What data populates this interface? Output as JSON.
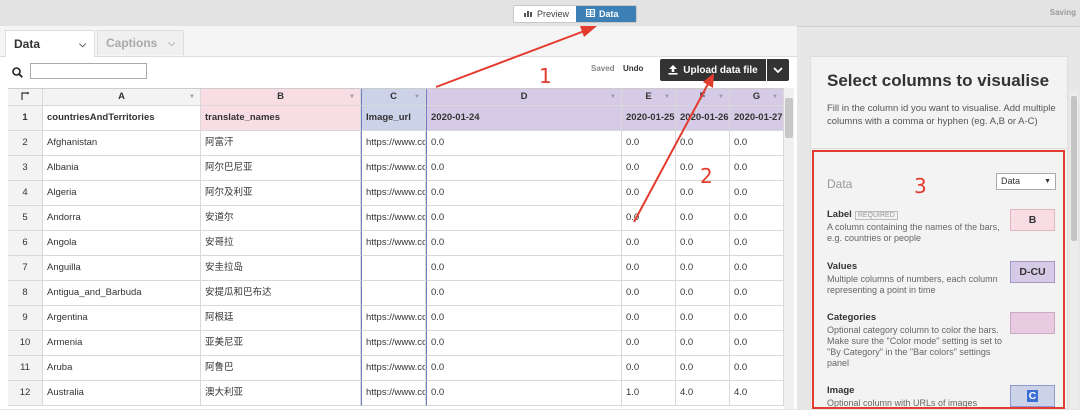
{
  "topbar": {
    "preview_label": "Preview",
    "data_label": "Data",
    "saving_label": "Saving"
  },
  "tabs": [
    {
      "label": "Data",
      "active": true
    },
    {
      "label": "Captions",
      "active": false
    }
  ],
  "toolbar": {
    "search_placeholder": "",
    "saved_label": "Saved",
    "undo_label": "Undo",
    "upload_label": "Upload data file"
  },
  "grid": {
    "columns": [
      "A",
      "B",
      "C",
      "D",
      "E",
      "F",
      "G"
    ],
    "header_row": {
      "num": "1",
      "cells": [
        "countriesAndTerritories",
        "translate_names",
        "Image_url",
        "2020-01-24",
        "2020-01-25",
        "2020-01-26",
        "2020-01-27"
      ]
    },
    "rows": [
      {
        "num": "2",
        "cells": [
          "Afghanistan",
          "阿富汗",
          "https://www.cc",
          "0.0",
          "0.0",
          "0.0",
          "0.0"
        ]
      },
      {
        "num": "3",
        "cells": [
          "Albania",
          "阿尔巴尼亚",
          "https://www.cc",
          "0.0",
          "0.0",
          "0.0",
          "0.0"
        ]
      },
      {
        "num": "4",
        "cells": [
          "Algeria",
          "阿尔及利亚",
          "https://www.cc",
          "0.0",
          "0.0",
          "0.0",
          "0.0"
        ]
      },
      {
        "num": "5",
        "cells": [
          "Andorra",
          "安道尔",
          "https://www.cc",
          "0.0",
          "0.0",
          "0.0",
          "0.0"
        ]
      },
      {
        "num": "6",
        "cells": [
          "Angola",
          "安哥拉",
          "https://www.cc",
          "0.0",
          "0.0",
          "0.0",
          "0.0"
        ]
      },
      {
        "num": "7",
        "cells": [
          "Anguilla",
          "安圭拉岛",
          "",
          "0.0",
          "0.0",
          "0.0",
          "0.0"
        ]
      },
      {
        "num": "8",
        "cells": [
          "Antigua_and_Barbuda",
          "安提瓜和巴布达",
          "",
          "0.0",
          "0.0",
          "0.0",
          "0.0"
        ]
      },
      {
        "num": "9",
        "cells": [
          "Argentina",
          "阿根廷",
          "https://www.cc",
          "0.0",
          "0.0",
          "0.0",
          "0.0"
        ]
      },
      {
        "num": "10",
        "cells": [
          "Armenia",
          "亚美尼亚",
          "https://www.cc",
          "0.0",
          "0.0",
          "0.0",
          "0.0"
        ]
      },
      {
        "num": "11",
        "cells": [
          "Aruba",
          "阿鲁巴",
          "https://www.cc",
          "0.0",
          "0.0",
          "0.0",
          "0.0"
        ]
      },
      {
        "num": "12",
        "cells": [
          "Australia",
          "澳大利亚",
          "https://www.cc",
          "0.0",
          "1.0",
          "4.0",
          "4.0"
        ]
      }
    ]
  },
  "panel": {
    "title": "Select columns to visualise",
    "description": "Fill in the column id you want to visualise. Add multiple columns with a comma or hyphen (eg. A,B or A-C)",
    "section_label": "Data",
    "sheet_select": "Data",
    "fields": [
      {
        "name": "Label",
        "required": "REQUIRED",
        "desc": "A column containing the names of the bars, e.g. countries or people",
        "value": "B"
      },
      {
        "name": "Values",
        "required": "",
        "desc": "Multiple columns of numbers, each column representing a point in time",
        "value": "D-CU"
      },
      {
        "name": "Categories",
        "required": "",
        "desc": "Optional category column to color the bars. Make sure the \"Color mode\" setting is set to \"By Category\" in the \"Bar colors\" settings panel",
        "value": ""
      },
      {
        "name": "Image",
        "required": "",
        "desc": "Optional column with URLs of images",
        "value": "C"
      }
    ]
  },
  "annotations": [
    "1",
    "2",
    "3"
  ],
  "colors": {
    "accent": "#3c80b5",
    "annotation": "#e33b2e"
  }
}
